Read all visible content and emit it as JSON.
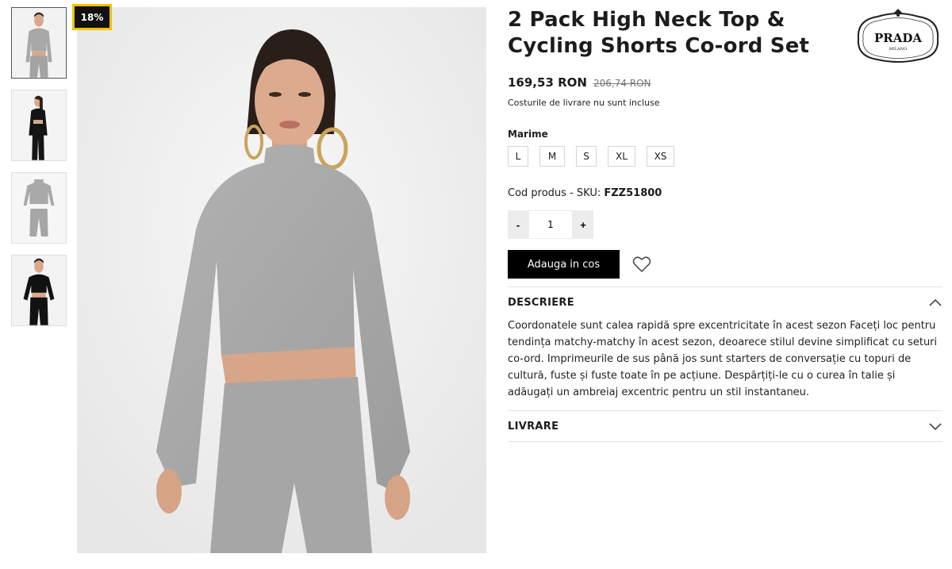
{
  "product": {
    "discount_badge": "18%",
    "title": "2 Pack High Neck Top & Cycling Shorts Co-ord Set",
    "brand": "PRADA",
    "brand_sub": "MILANO",
    "price_current": "169,53 RON",
    "price_old": "206,74 RON",
    "shipping_note": "Costurile de livrare nu sunt incluse",
    "size_label": "Marime",
    "sizes": [
      "L",
      "M",
      "S",
      "XL",
      "XS"
    ],
    "sku_label": "Cod produs - SKU:",
    "sku_value": "FZZ51800",
    "quantity": "1",
    "qty_minus": "-",
    "qty_plus": "+",
    "add_to_cart": "Adauga in cos"
  },
  "accordion": {
    "description_title": "DESCRIERE",
    "description_text": "Coordonatele sunt calea rapidă spre excentricitate în acest sezon Faceți loc pentru tendința matchy-matchy în acest sezon, deoarece stilul devine simplificat cu seturi co-ord. Imprimeurile de sus până jos sunt starters de conversație cu topuri de cultură, fuste și fuste toate în pe acțiune. Despărțiți-le cu o curea în talie și adăugați un ambreiaj excentric pentru un stil instantaneu.",
    "delivery_title": "LIVRARE"
  },
  "icons": {
    "wishlist": "heart-icon",
    "description_toggle": "chevron-up-icon",
    "delivery_toggle": "chevron-down-icon"
  },
  "colors": {
    "badge_border": "#f2c200",
    "button_bg": "#000000",
    "garment": "#a9a9a9"
  }
}
